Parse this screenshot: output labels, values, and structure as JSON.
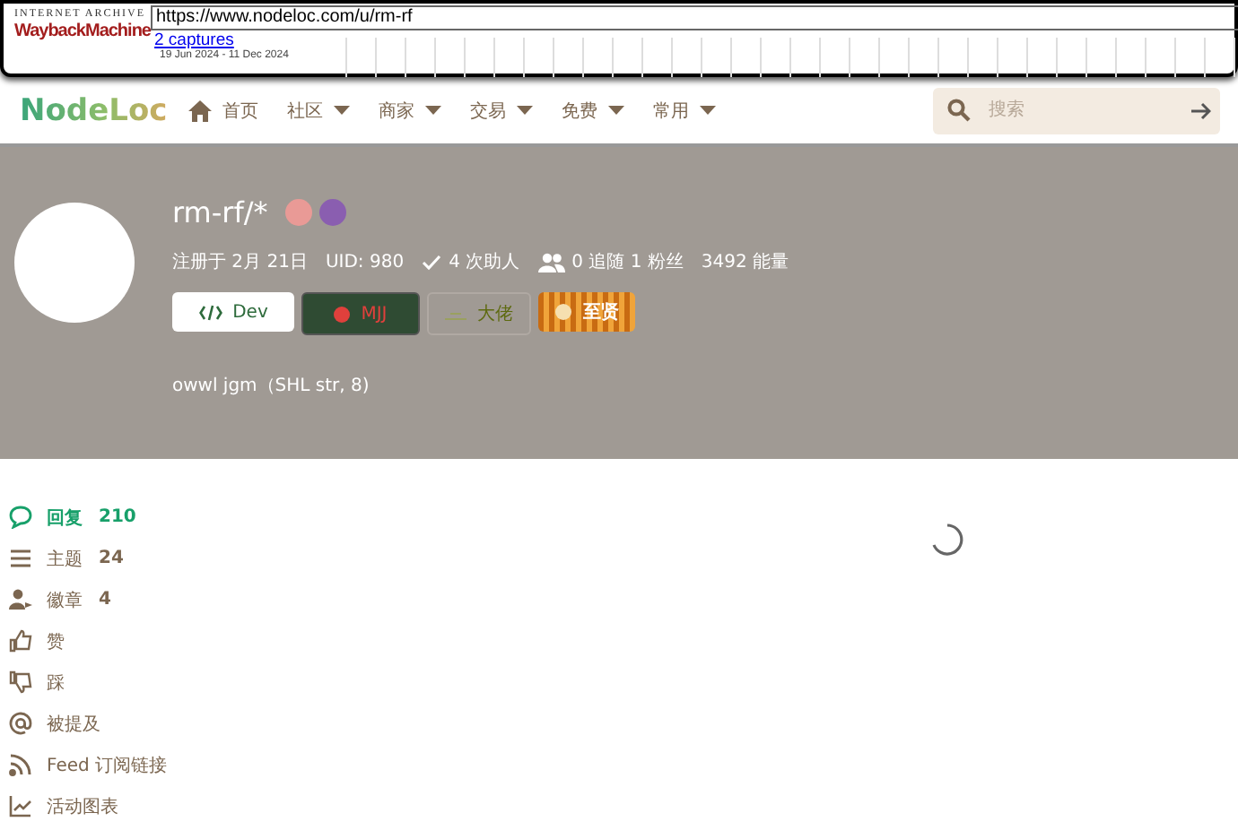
{
  "wayback": {
    "brand_top": "INTERNET ARCHIVE",
    "brand": "WaybackMachine",
    "url": "https://www.nodeloc.com/u/rm-rf",
    "captures": "2 captures",
    "date_range": "19 Jun 2024 - 11 Dec 2024"
  },
  "nav": {
    "logo": "NodeLoc",
    "items": [
      {
        "label": "首页",
        "kind": "home"
      },
      {
        "label": "社区",
        "kind": "menu"
      },
      {
        "label": "商家",
        "kind": "menu"
      },
      {
        "label": "交易",
        "kind": "menu"
      },
      {
        "label": "免费",
        "kind": "menu"
      },
      {
        "label": "常用",
        "kind": "menu"
      }
    ],
    "search": {
      "placeholder": "搜索"
    }
  },
  "profile": {
    "username": "rm-rf/*",
    "stats": [
      {
        "text": "注册于 2月 21日",
        "kind": "plain"
      },
      {
        "text": "UID: 980",
        "kind": "plain"
      },
      {
        "text": "4 次助人",
        "kind": "check"
      },
      {
        "text": "0 追随 1 粉丝",
        "kind": "people"
      },
      {
        "text": "3492 能量",
        "kind": "plain"
      }
    ],
    "badges": [
      {
        "label": "Dev",
        "kind": "code"
      },
      {
        "label": "MJJ",
        "kind": "dot"
      },
      {
        "label": "大佬",
        "kind": "faded"
      },
      {
        "label": "至贤",
        "kind": "gold"
      }
    ],
    "bio": "owwl jgm（SHL str, 8)"
  },
  "sidebar": {
    "items": [
      {
        "label": "回复",
        "count": "210",
        "selected": true,
        "kind": "bubble"
      },
      {
        "label": "主题",
        "count": "24",
        "selected": false,
        "kind": "lines"
      },
      {
        "label": "徽章",
        "count": "4",
        "selected": false,
        "kind": "user"
      },
      {
        "label": "赞",
        "selected": false,
        "kind": "up"
      },
      {
        "label": "踩",
        "selected": false,
        "kind": "down"
      },
      {
        "label": "被提及",
        "selected": false,
        "kind": "at"
      },
      {
        "label": "Feed 订阅链接",
        "selected": false,
        "kind": "rss"
      },
      {
        "label": "活动图表",
        "selected": false,
        "kind": "chart"
      }
    ]
  }
}
